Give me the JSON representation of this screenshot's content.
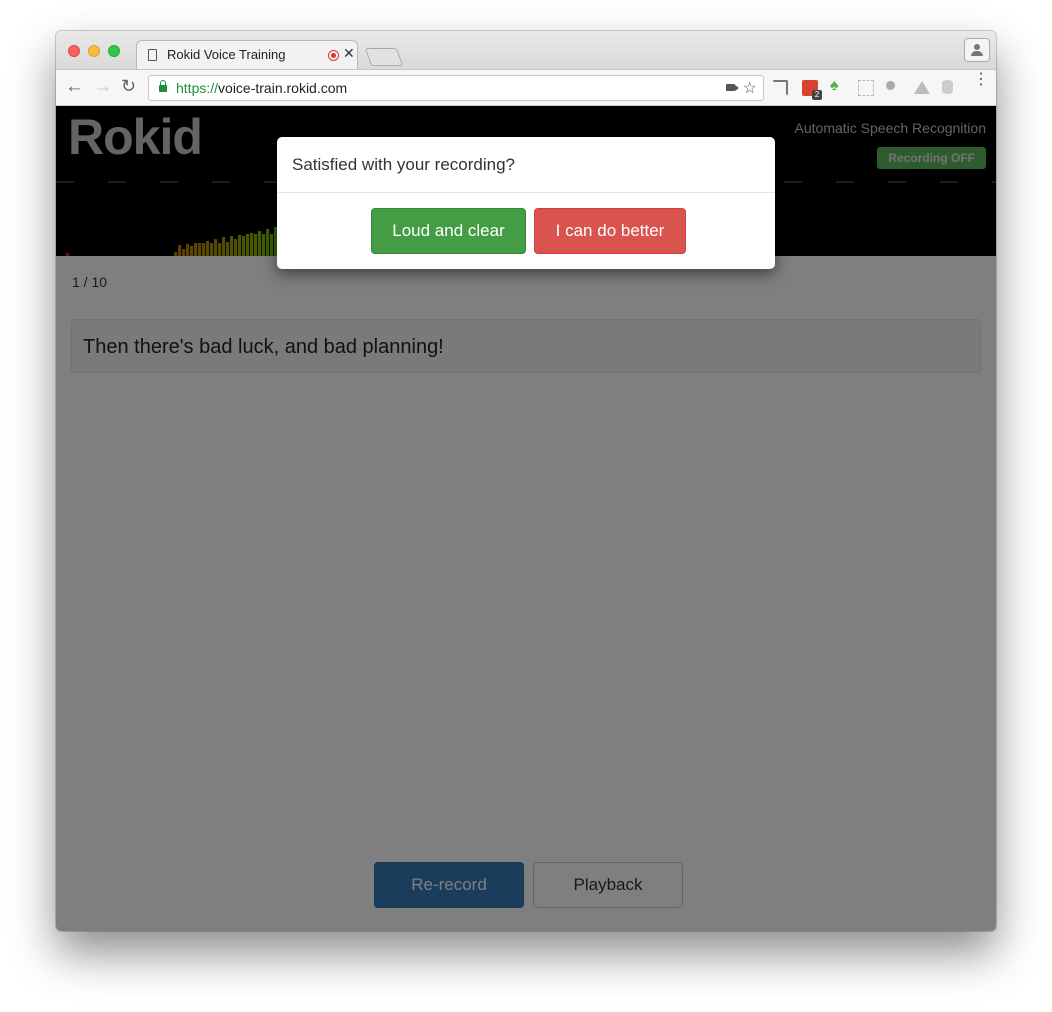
{
  "browser": {
    "tab_title": "Rokid Voice Training",
    "url_scheme": "https://",
    "url_host": "voice-train.rokid.com"
  },
  "header": {
    "logo_text": "Rokid",
    "subtitle": "Automatic Speech Recognition",
    "recording_status": "Recording OFF"
  },
  "progress": {
    "counter": "1 / 10"
  },
  "prompt": {
    "sentence": "Then there's bad luck, and bad planning!"
  },
  "actions": {
    "rerecord_label": "Re-record",
    "playback_label": "Playback"
  },
  "modal": {
    "title": "Satisfied with your recording?",
    "accept_label": "Loud and clear",
    "reject_label": "I can do better"
  },
  "colors": {
    "accept": "#449d44",
    "reject": "#d9534f",
    "rerecord": "#337ab7",
    "recording_badge": "#5cb85c"
  }
}
